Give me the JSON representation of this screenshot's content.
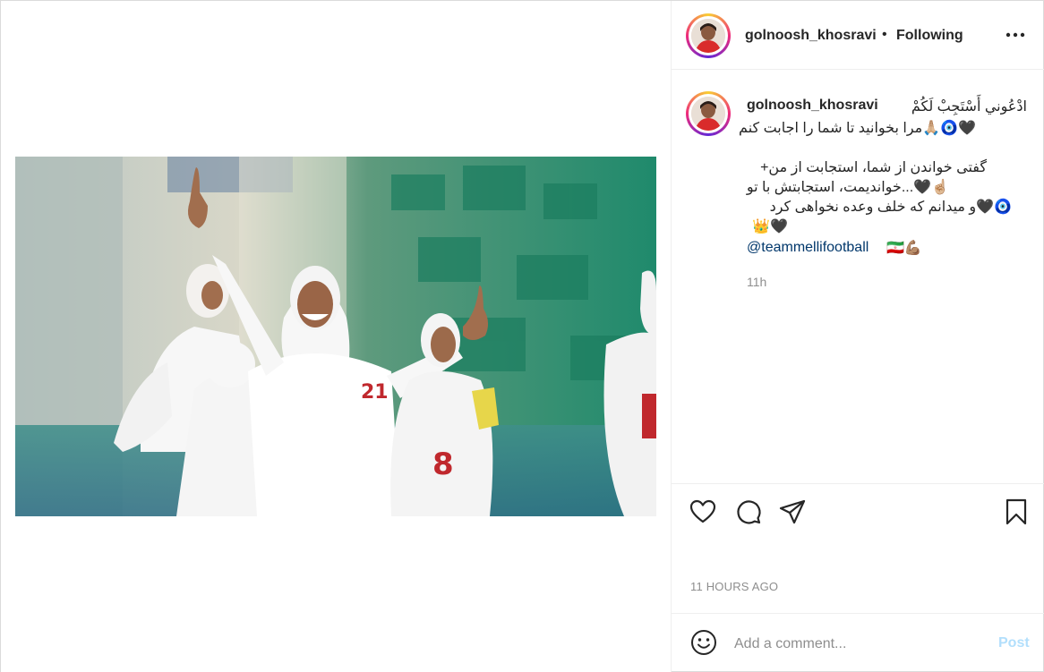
{
  "post": {
    "author": {
      "username": "golnoosh_khosravi",
      "follow_status": "Following",
      "separator": "•"
    },
    "caption": {
      "username": "golnoosh_khosravi",
      "lines": [
        "ادْعُوني أَسْتَجِبْ لَكُمْ",
        "🖤🧿🙏🏼مرا بخوانید تا شما را اجابت کنم",
        "",
        "گفتی خواندن از شما، استجابت از من+",
        "☝🏼🖤...خواندیمت، استجابتش با تو",
        "🧿🖤و میدانم که خلف وعده نخواهی کرد",
        "👑🖤"
      ],
      "mention": "@teammellifootball",
      "mention_emoji": "🇮🇷💪🏽",
      "relative_time": "11h"
    },
    "timestamp": "11 HOURS AGO",
    "comment": {
      "placeholder": "Add a comment...",
      "post_label": "Post"
    },
    "icons": {
      "more": "more-options-icon",
      "like": "heart-icon",
      "comment": "comment-icon",
      "share": "share-icon",
      "save": "bookmark-icon",
      "emoji": "emoji-icon"
    },
    "colors": {
      "text": "#262626",
      "muted": "#8e8e8e",
      "link": "#00376b",
      "post_disabled": "#b2dffc",
      "border": "#dbdbdb"
    }
  }
}
